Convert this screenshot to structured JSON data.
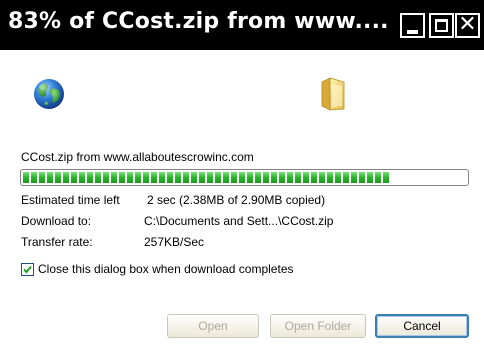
{
  "window": {
    "title": "83% of CCost.zip from www....",
    "controls": [
      "minimize",
      "maximize",
      "close"
    ],
    "close_glyph": "✕"
  },
  "icons": {
    "source_icon": "globe-icon",
    "destination_icon": "folder-icon"
  },
  "download": {
    "source_line": "CCost.zip from www.allaboutescrowinc.com",
    "progress_fraction": 0.83,
    "time_left_label": "Estimated time left",
    "time_left_value": "2 sec (2.38MB of 2.90MB copied)",
    "download_to_label": "Download to:",
    "download_to_value": "C:\\Documents and Sett...\\CCost.zip",
    "transfer_rate_label": "Transfer rate:",
    "transfer_rate_value": "257KB/Sec"
  },
  "options": {
    "close_when_done_label": "Close this dialog box when download completes",
    "close_when_done_checked": true
  },
  "buttons": {
    "open_label": "Open",
    "open_enabled": false,
    "open_folder_label": "Open Folder",
    "open_folder_enabled": false,
    "cancel_label": "Cancel",
    "cancel_enabled": true
  },
  "colors": {
    "title_bar": "#000000",
    "progress_fill": "#2fb82f",
    "default_button_border": "#3c7fb1"
  }
}
